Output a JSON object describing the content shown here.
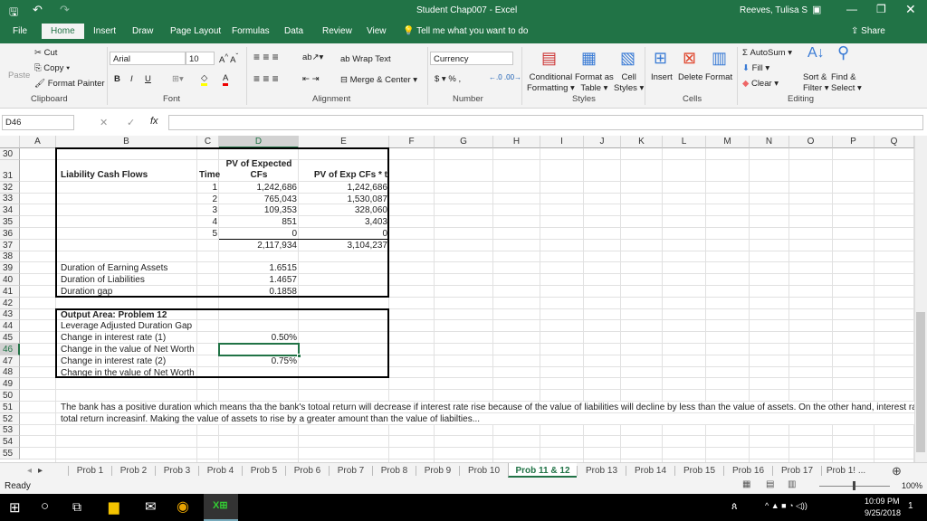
{
  "window": {
    "title": "Student Chap007  -  Excel",
    "user": "Reeves, Tulisa S"
  },
  "ribbon_tabs": [
    "File",
    "Home",
    "Insert",
    "Draw",
    "Page Layout",
    "Formulas",
    "Data",
    "Review",
    "View"
  ],
  "tell_me": "Tell me what you want to do",
  "share": "Share",
  "clipboard": {
    "paste": "Paste",
    "cut": "Cut",
    "copy": "Copy",
    "format_painter": "Format Painter",
    "group": "Clipboard"
  },
  "font": {
    "name": "Arial",
    "size": "10",
    "bold": "B",
    "italic": "I",
    "underline": "U",
    "group": "Font"
  },
  "alignment": {
    "wrap": "Wrap Text",
    "merge": "Merge & Center",
    "group": "Alignment"
  },
  "number": {
    "format": "Currency",
    "currency": "$",
    "percent": "%",
    "comma": ",",
    "group": "Number"
  },
  "styles": {
    "conditional": [
      "Conditional",
      "Formatting"
    ],
    "format_table": [
      "Format as",
      "Table"
    ],
    "cell_styles": [
      "Cell",
      "Styles"
    ],
    "group": "Styles"
  },
  "cells": {
    "insert": "Insert",
    "delete": "Delete",
    "format": "Format",
    "group": "Cells"
  },
  "editing": {
    "autosum": "AutoSum",
    "fill": "Fill",
    "clear": "Clear",
    "sort": [
      "Sort &",
      "Filter"
    ],
    "find": [
      "Find &",
      "Select"
    ],
    "group": "Editing"
  },
  "formula_bar": {
    "name_box": "D46",
    "fx": "fx",
    "value": ""
  },
  "columns": [
    "A",
    "B",
    "C",
    "D",
    "E",
    "F",
    "G",
    "H",
    "I",
    "J",
    "K",
    "L",
    "M",
    "N",
    "O",
    "P",
    "Q"
  ],
  "rows": [
    30,
    31,
    32,
    33,
    34,
    35,
    36,
    37,
    38,
    39,
    40,
    41,
    42,
    43,
    44,
    45,
    46,
    47,
    48,
    49,
    50,
    51,
    52,
    53,
    54,
    55
  ],
  "cells_data": [
    {
      "c": "B",
      "r": 31,
      "v": "Liability Cash Flows",
      "cls": "b"
    },
    {
      "c": "C",
      "r": 31,
      "v": "Time",
      "cls": "b r"
    },
    {
      "c": "D",
      "r": 30,
      "v": "PV of Expected",
      "cls": "b cen2"
    },
    {
      "c": "D",
      "r": 31,
      "v": "CFs",
      "cls": "b cen"
    },
    {
      "c": "E",
      "r": 31,
      "v": "PV of Exp CFs * t",
      "cls": "b r"
    },
    {
      "c": "C",
      "r": 32,
      "v": "1",
      "cls": "r"
    },
    {
      "c": "D",
      "r": 32,
      "v": "1,242,686",
      "cls": "r"
    },
    {
      "c": "E",
      "r": 32,
      "v": "1,242,686",
      "cls": "r"
    },
    {
      "c": "C",
      "r": 33,
      "v": "2",
      "cls": "r"
    },
    {
      "c": "D",
      "r": 33,
      "v": "765,043",
      "cls": "r"
    },
    {
      "c": "E",
      "r": 33,
      "v": "1,530,087",
      "cls": "r"
    },
    {
      "c": "C",
      "r": 34,
      "v": "3",
      "cls": "r"
    },
    {
      "c": "D",
      "r": 34,
      "v": "109,353",
      "cls": "r"
    },
    {
      "c": "E",
      "r": 34,
      "v": "328,060",
      "cls": "r"
    },
    {
      "c": "C",
      "r": 35,
      "v": "4",
      "cls": "r"
    },
    {
      "c": "D",
      "r": 35,
      "v": "851",
      "cls": "r"
    },
    {
      "c": "E",
      "r": 35,
      "v": "3,403",
      "cls": "r"
    },
    {
      "c": "C",
      "r": 36,
      "v": "5",
      "cls": "r"
    },
    {
      "c": "D",
      "r": 36,
      "v": "0",
      "cls": "r"
    },
    {
      "c": "E",
      "r": 36,
      "v": "0",
      "cls": "r"
    },
    {
      "c": "D",
      "r": 37,
      "v": "2,117,934",
      "cls": "r"
    },
    {
      "c": "E",
      "r": 37,
      "v": "3,104,237",
      "cls": "r"
    },
    {
      "c": "B",
      "r": 39,
      "v": "Duration of  Earning Assets",
      "cls": ""
    },
    {
      "c": "D",
      "r": 39,
      "v": "1.6515",
      "cls": "r"
    },
    {
      "c": "B",
      "r": 40,
      "v": "Duration of Liabilities",
      "cls": ""
    },
    {
      "c": "D",
      "r": 40,
      "v": "1.4657",
      "cls": "r"
    },
    {
      "c": "B",
      "r": 41,
      "v": "Duration gap",
      "cls": ""
    },
    {
      "c": "D",
      "r": 41,
      "v": "0.1858",
      "cls": "r"
    },
    {
      "c": "B",
      "r": 43,
      "v": "Output Area: Problem 12",
      "cls": "b"
    },
    {
      "c": "B",
      "r": 44,
      "v": "Leverage Adjusted Duration Gap",
      "cls": ""
    },
    {
      "c": "B",
      "r": 45,
      "v": "Change in interest rate (1)",
      "cls": ""
    },
    {
      "c": "D",
      "r": 45,
      "v": "0.50%",
      "cls": "r"
    },
    {
      "c": "B",
      "r": 46,
      "v": "Change in the value of Net Worth",
      "cls": ""
    },
    {
      "c": "B",
      "r": 47,
      "v": "Change in interest rate (2)",
      "cls": ""
    },
    {
      "c": "D",
      "r": 47,
      "v": "0.75%",
      "cls": "r"
    },
    {
      "c": "B",
      "r": 48,
      "v": "Change in the value of Net Worth",
      "cls": ""
    },
    {
      "c": "B",
      "r": 51,
      "v": "The bank has a positive duration which means tha the bank's totoal return will decrease if interest rate rise because of the value of liabilities will decline by less than the value of assets. On the other hand, interest rate w",
      "cls": ""
    },
    {
      "c": "B",
      "r": 52,
      "v": "total return increasinf. Making the value of assets to rise by a greater amount than the value of liabilties...",
      "cls": ""
    }
  ],
  "sheet_tabs": [
    "Prob 1",
    "Prob 2",
    "Prob 3",
    "Prob 4",
    "Prob 5",
    "Prob 6",
    "Prob 7",
    "Prob 8",
    "Prob 9",
    "Prob 10",
    "Prob 11 & 12",
    "Prob 13",
    "Prob 14",
    "Prob 15",
    "Prob 16",
    "Prob 17",
    "Prob 1! ..."
  ],
  "active_sheet": "Prob 11 & 12",
  "status": {
    "mode": "Ready",
    "zoom": "100%"
  },
  "taskbar": {
    "time": "10:09 PM",
    "date": "9/25/2018",
    "notifications": "1"
  },
  "colors": {
    "accent": "#217346"
  }
}
